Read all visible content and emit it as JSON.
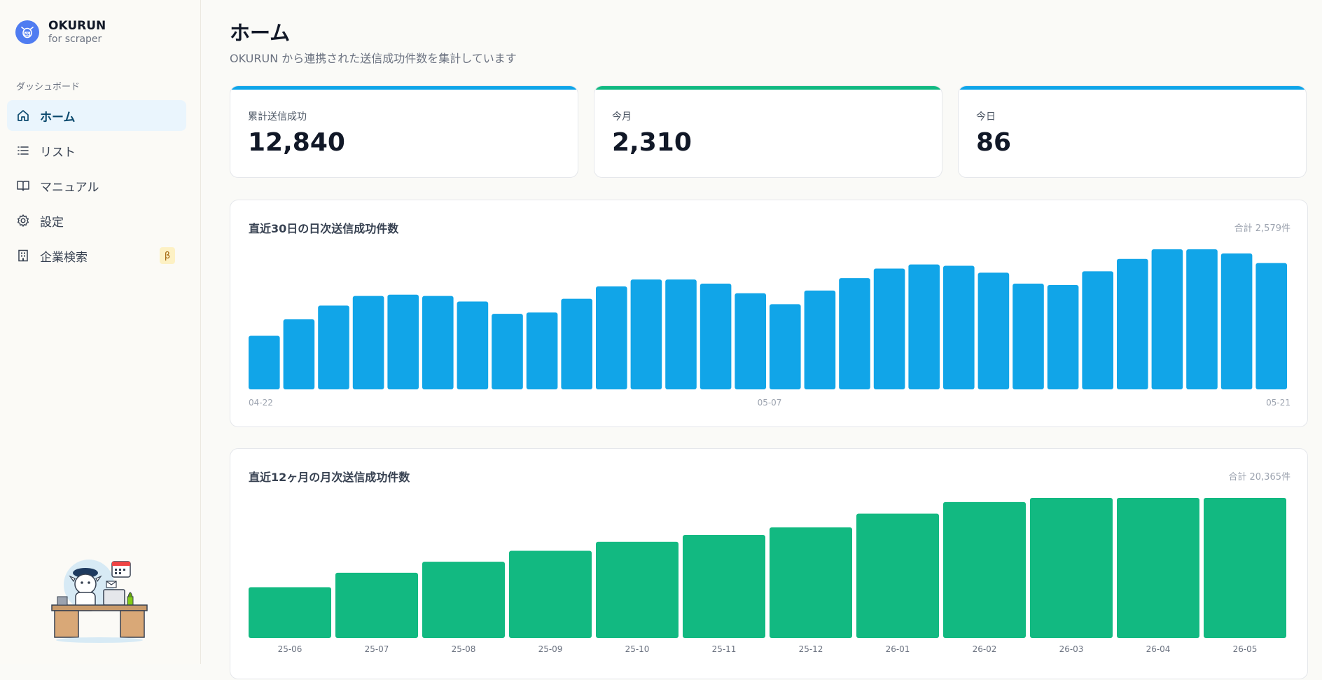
{
  "brand": {
    "name": "OKURUN",
    "sub": "for scraper"
  },
  "sidebar": {
    "section_label": "ダッシュボード",
    "items": [
      {
        "label": "ホーム",
        "icon": "home-icon",
        "active": true
      },
      {
        "label": "リスト",
        "icon": "list-icon",
        "active": false
      },
      {
        "label": "マニュアル",
        "icon": "book-icon",
        "active": false
      },
      {
        "label": "設定",
        "icon": "gear-icon",
        "active": false
      },
      {
        "label": "企業検索",
        "icon": "building-icon",
        "active": false,
        "badge": "β"
      }
    ]
  },
  "header": {
    "title": "ホーム",
    "subtitle": "OKURUN から連携された送信成功件数を集計しています"
  },
  "stats": [
    {
      "label": "累計送信成功",
      "value": "12,840",
      "accent": "#0ea5e9"
    },
    {
      "label": "今月",
      "value": "2,310",
      "accent": "#10b981"
    },
    {
      "label": "今日",
      "value": "86",
      "accent": "#0ea5e9"
    }
  ],
  "daily_chart": {
    "title": "直近30日の日次送信成功件数",
    "total": "合計 2,579件",
    "color": "#11a5e8"
  },
  "monthly_chart": {
    "title": "直近12ヶ月の月次送信成功件数",
    "total": "合計 20,365件",
    "color": "#12b981"
  },
  "chart_data": [
    {
      "type": "bar",
      "title": "直近30日の日次送信成功件数",
      "tick_labels": [
        "04-22",
        "05-07",
        "05-21"
      ],
      "values": [
        39,
        51,
        61,
        68,
        69,
        68,
        64,
        55,
        56,
        66,
        75,
        80,
        80,
        77,
        70,
        62,
        72,
        81,
        88,
        91,
        90,
        85,
        77,
        76,
        86,
        95,
        102,
        102,
        99,
        92
      ]
    },
    {
      "type": "bar",
      "title": "直近12ヶ月の月次送信成功件数",
      "categories": [
        "25-06",
        "25-07",
        "25-08",
        "25-09",
        "25-10",
        "25-11",
        "25-12",
        "26-01",
        "26-02",
        "26-03",
        "26-04",
        "26-05"
      ],
      "values": [
        740,
        950,
        1110,
        1270,
        1400,
        1500,
        1610,
        1810,
        1980,
        2040,
        2040,
        2040
      ]
    }
  ]
}
